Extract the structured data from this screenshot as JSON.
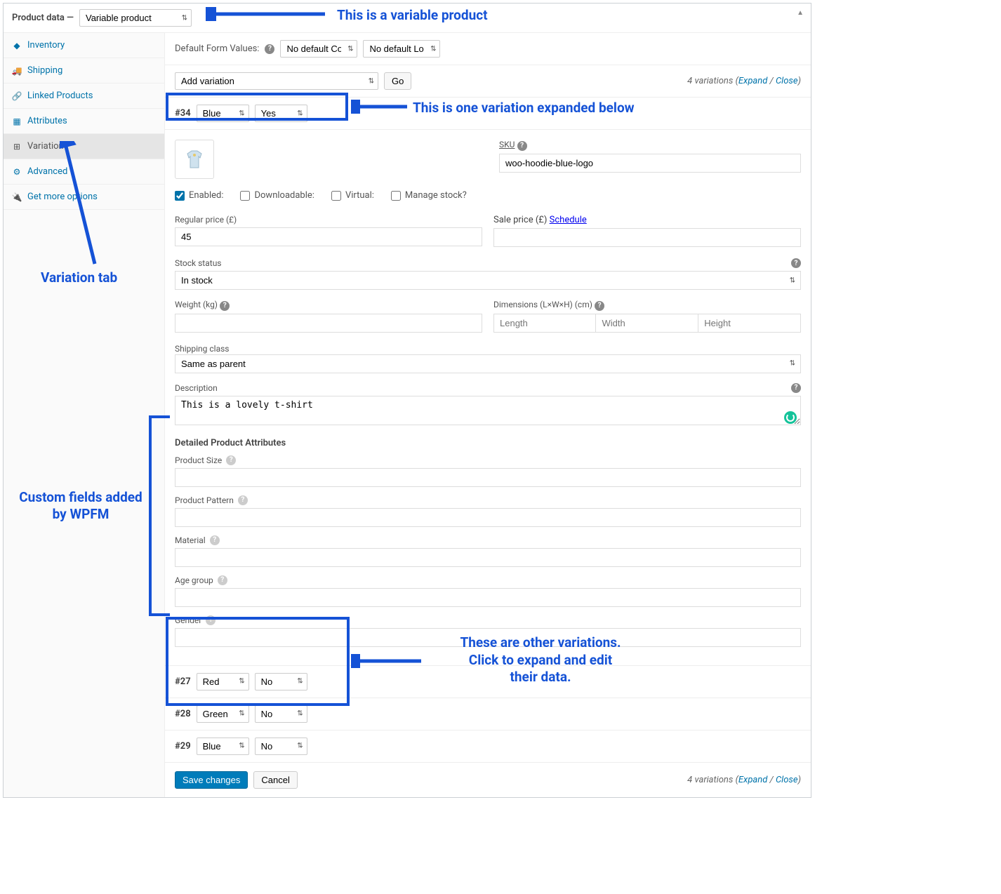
{
  "header": {
    "title_prefix": "Product data —",
    "product_type": "Variable product"
  },
  "sidebar": [
    {
      "icon": "inventory",
      "label": "Inventory",
      "active": false
    },
    {
      "icon": "shipping",
      "label": "Shipping",
      "active": false
    },
    {
      "icon": "linked",
      "label": "Linked Products",
      "active": false
    },
    {
      "icon": "attributes",
      "label": "Attributes",
      "active": false
    },
    {
      "icon": "variations",
      "label": "Variations",
      "active": true
    },
    {
      "icon": "advanced",
      "label": "Advanced",
      "active": false
    },
    {
      "icon": "more",
      "label": "Get more options",
      "active": false
    }
  ],
  "defaults_row": {
    "label": "Default Form Values:",
    "color_sel": "No default Color…",
    "logo_sel": "No default Logo…"
  },
  "toolbar": {
    "add_variation": "Add variation",
    "go": "Go",
    "count_text": "4 variations",
    "expand": "Expand",
    "close": "Close"
  },
  "variation34": {
    "id": "#34",
    "attr1": "Blue",
    "attr2": "Yes",
    "sku_label": "SKU",
    "sku": "woo-hoodie-blue-logo",
    "enabled_label": "Enabled:",
    "downloadable_label": "Downloadable:",
    "virtual_label": "Virtual:",
    "manage_stock_label": "Manage stock?",
    "regular_price_label": "Regular price (£)",
    "regular_price": "45",
    "sale_price_label": "Sale price (£)",
    "schedule": "Schedule",
    "stock_status_label": "Stock status",
    "stock_status": "In stock",
    "weight_label": "Weight (kg)",
    "dimensions_label": "Dimensions (L×W×H) (cm)",
    "dim_length": "Length",
    "dim_width": "Width",
    "dim_height": "Height",
    "shipping_class_label": "Shipping class",
    "shipping_class": "Same as parent",
    "description_label": "Description",
    "description": "This is a lovely t-shirt",
    "dpa_title": "Detailed Product Attributes",
    "dpa": [
      {
        "label": "Product Size"
      },
      {
        "label": "Product Pattern"
      },
      {
        "label": "Material"
      },
      {
        "label": "Age group"
      },
      {
        "label": "Gender"
      }
    ]
  },
  "collapsed": [
    {
      "id": "#27",
      "attr1": "Red",
      "attr2": "No"
    },
    {
      "id": "#28",
      "attr1": "Green",
      "attr2": "No"
    },
    {
      "id": "#29",
      "attr1": "Blue",
      "attr2": "No"
    }
  ],
  "footer": {
    "save": "Save changes",
    "cancel": "Cancel"
  },
  "annotations": {
    "a1": "This is a variable product",
    "a2": "This is one variation expanded below",
    "a3": "Variation tab",
    "a4": "Custom fields added by WPFM",
    "a5_l1": "These are other variations.",
    "a5_l2": "Click to expand and edit",
    "a5_l3": "their data."
  }
}
